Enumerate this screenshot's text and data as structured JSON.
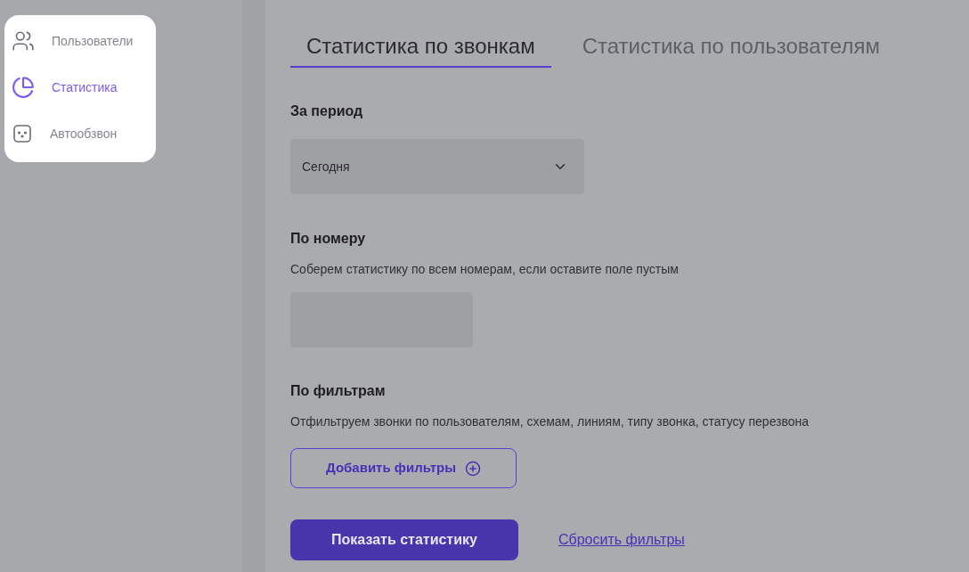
{
  "sidebar": {
    "items": [
      {
        "label": "Пользователи",
        "kind": "users",
        "selected": false
      },
      {
        "label": "Статистика",
        "kind": "chart",
        "selected": true
      },
      {
        "label": "Автообзвон",
        "kind": "robot",
        "selected": false
      }
    ]
  },
  "tabs": [
    {
      "label": "Статистика по звонкам",
      "selected": true
    },
    {
      "label": "Статистика по пользователям",
      "selected": false
    }
  ],
  "period": {
    "label": "За период",
    "value": "Сегодня"
  },
  "number": {
    "label": "По номеру",
    "hint": "Соберем статистику по всем номерам, если оставите поле пустым"
  },
  "filters": {
    "label": "По фильтрам",
    "hint": "Отфильтруем звонки по пользователям, схемам, линиям, типу звонка, статусу перезвона",
    "add_button": "Добавить фильтры"
  },
  "actions": {
    "submit": "Показать статистику",
    "reset": "Сбросить фильтры"
  }
}
